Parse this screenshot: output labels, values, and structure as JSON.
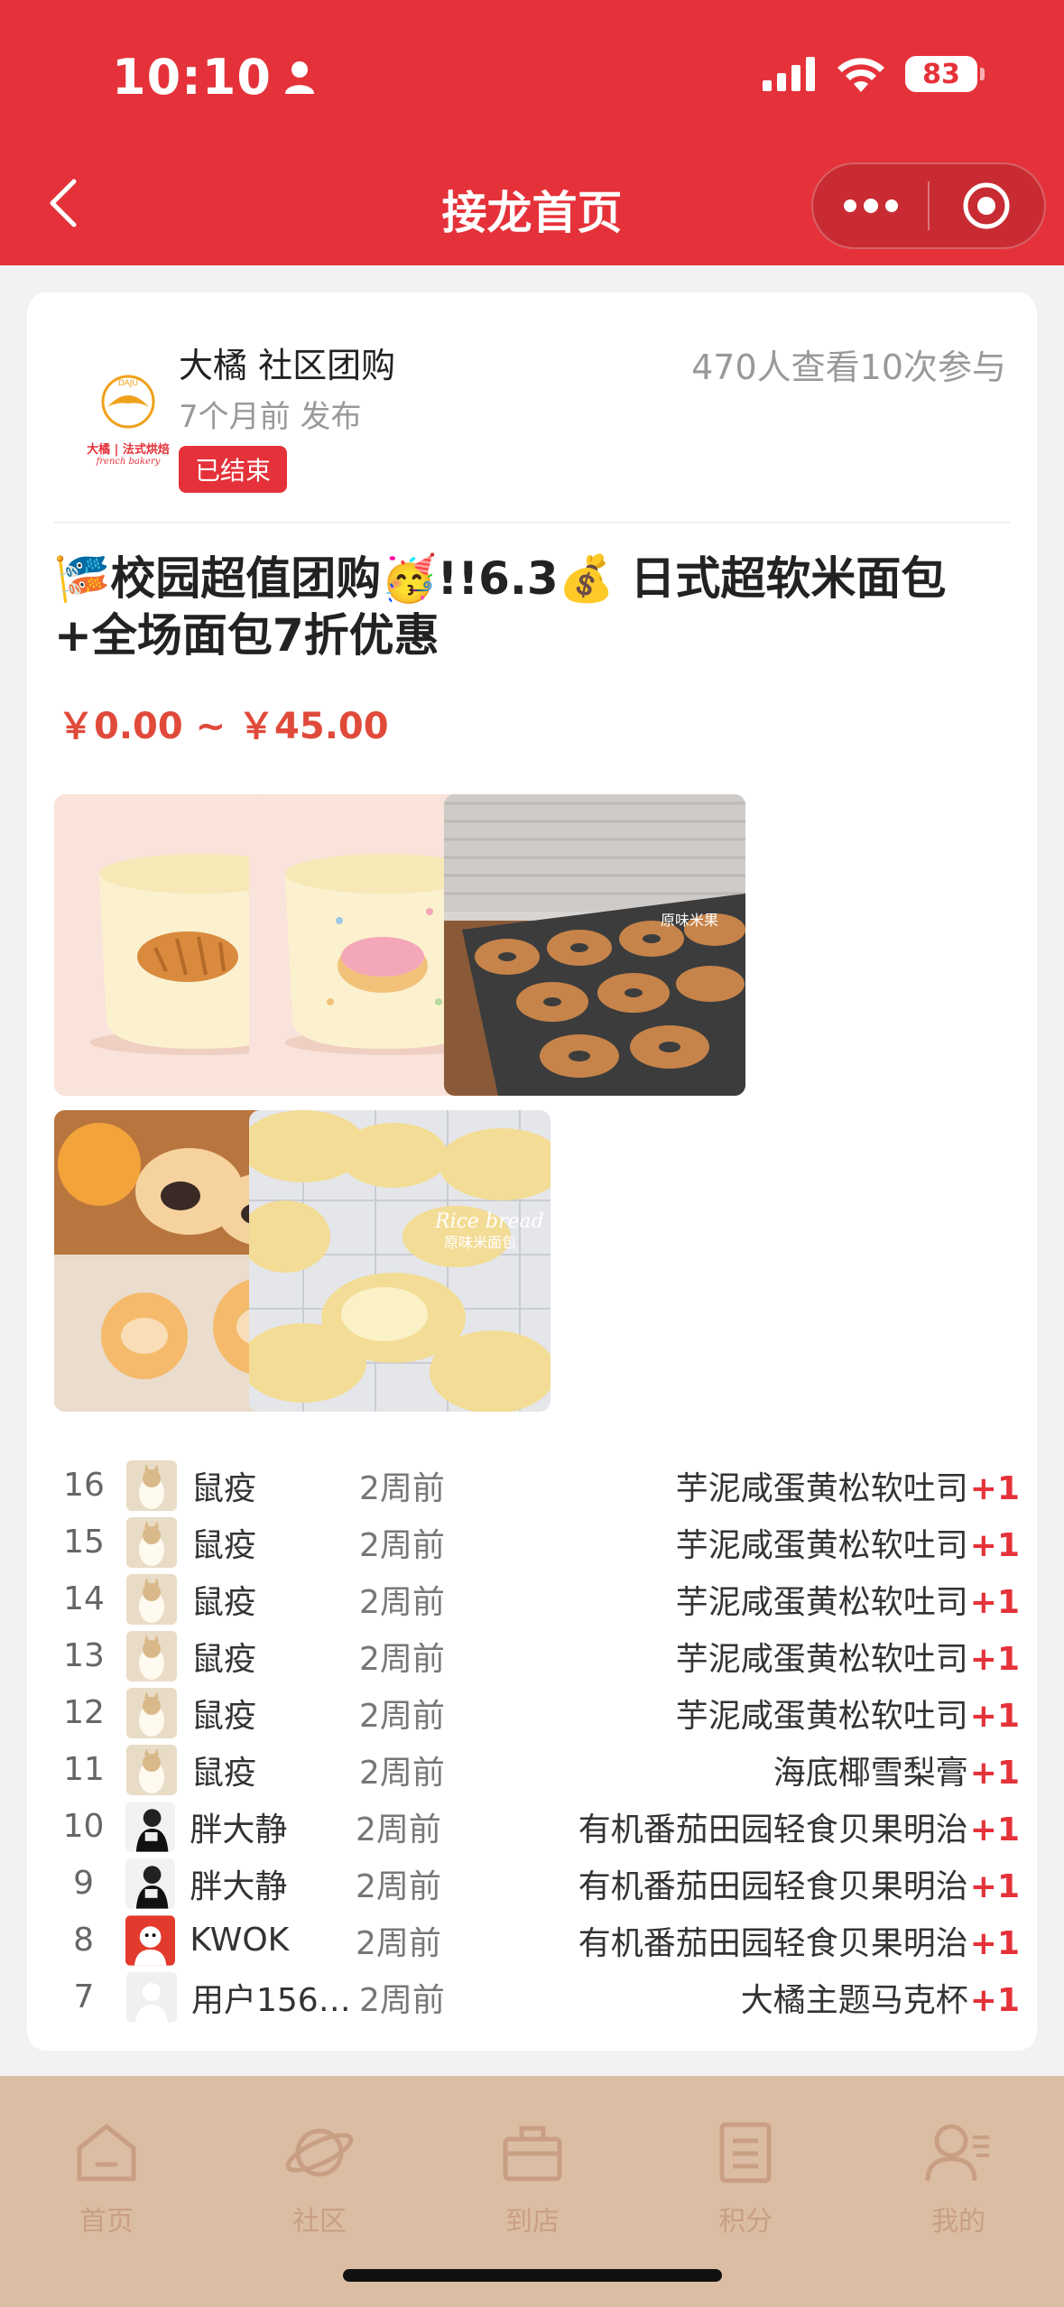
{
  "status_bar": {
    "time": "10:10",
    "battery": "83"
  },
  "nav": {
    "title": "接龙首页"
  },
  "shop": {
    "logo_text": "DAJU",
    "logo_sub": "大橘 | 法式烘焙",
    "logo_sub2": "french bakery",
    "name": "大橘 社区团购",
    "publish_time": "7个月前 发布",
    "status_badge": "已结束",
    "stats": "470人查看10次参与"
  },
  "post": {
    "title": "🎏校园超值团购🥳!!6.3💰 日式超软米面包+全场面包7折优惠",
    "price_range": "￥0.00 ~ ￥45.00"
  },
  "gallery": {
    "img3_caption": "原味米果",
    "img5_caption": "Rice bread",
    "img5_caption2": "原味米面包"
  },
  "orders": [
    {
      "num": "16",
      "name": "鼠疫",
      "time": "2周前",
      "item": "芋泥咸蛋黄松软吐司",
      "qty": "+1",
      "avatar": "cat"
    },
    {
      "num": "15",
      "name": "鼠疫",
      "time": "2周前",
      "item": "芋泥咸蛋黄松软吐司",
      "qty": "+1",
      "avatar": "cat"
    },
    {
      "num": "14",
      "name": "鼠疫",
      "time": "2周前",
      "item": "芋泥咸蛋黄松软吐司",
      "qty": "+1",
      "avatar": "cat"
    },
    {
      "num": "13",
      "name": "鼠疫",
      "time": "2周前",
      "item": "芋泥咸蛋黄松软吐司",
      "qty": "+1",
      "avatar": "cat"
    },
    {
      "num": "12",
      "name": "鼠疫",
      "time": "2周前",
      "item": "芋泥咸蛋黄松软吐司",
      "qty": "+1",
      "avatar": "cat"
    },
    {
      "num": "11",
      "name": "鼠疫",
      "time": "2周前",
      "item": "海底椰雪梨膏",
      "qty": "+1",
      "avatar": "cat"
    },
    {
      "num": "10",
      "name": "胖大静",
      "time": "2周前",
      "item": "有机番茄田园轻食贝果明治",
      "qty": "+1",
      "avatar": "bw"
    },
    {
      "num": "9",
      "name": "胖大静",
      "time": "2周前",
      "item": "有机番茄田园轻食贝果明治",
      "qty": "+1",
      "avatar": "bw"
    },
    {
      "num": "8",
      "name": "KWOK",
      "time": "2周前",
      "item": "有机番茄田园轻食贝果明治",
      "qty": "+1",
      "avatar": "red"
    },
    {
      "num": "7",
      "name": "用户156…",
      "time": "2周前",
      "item": "大橘主题马克杯",
      "qty": "+1",
      "avatar": "default"
    }
  ],
  "tabs": [
    {
      "label": "首页",
      "icon": "home-icon"
    },
    {
      "label": "社区",
      "icon": "planet-icon"
    },
    {
      "label": "到店",
      "icon": "shop-bag-icon"
    },
    {
      "label": "积分",
      "icon": "points-list-icon"
    },
    {
      "label": "我的",
      "icon": "profile-icon"
    }
  ],
  "colors": {
    "brand_red": "#e5323a",
    "price_red": "#e04a3a",
    "tabbar_bg": "#dbbda3",
    "tab_icon": "#c99f83"
  }
}
